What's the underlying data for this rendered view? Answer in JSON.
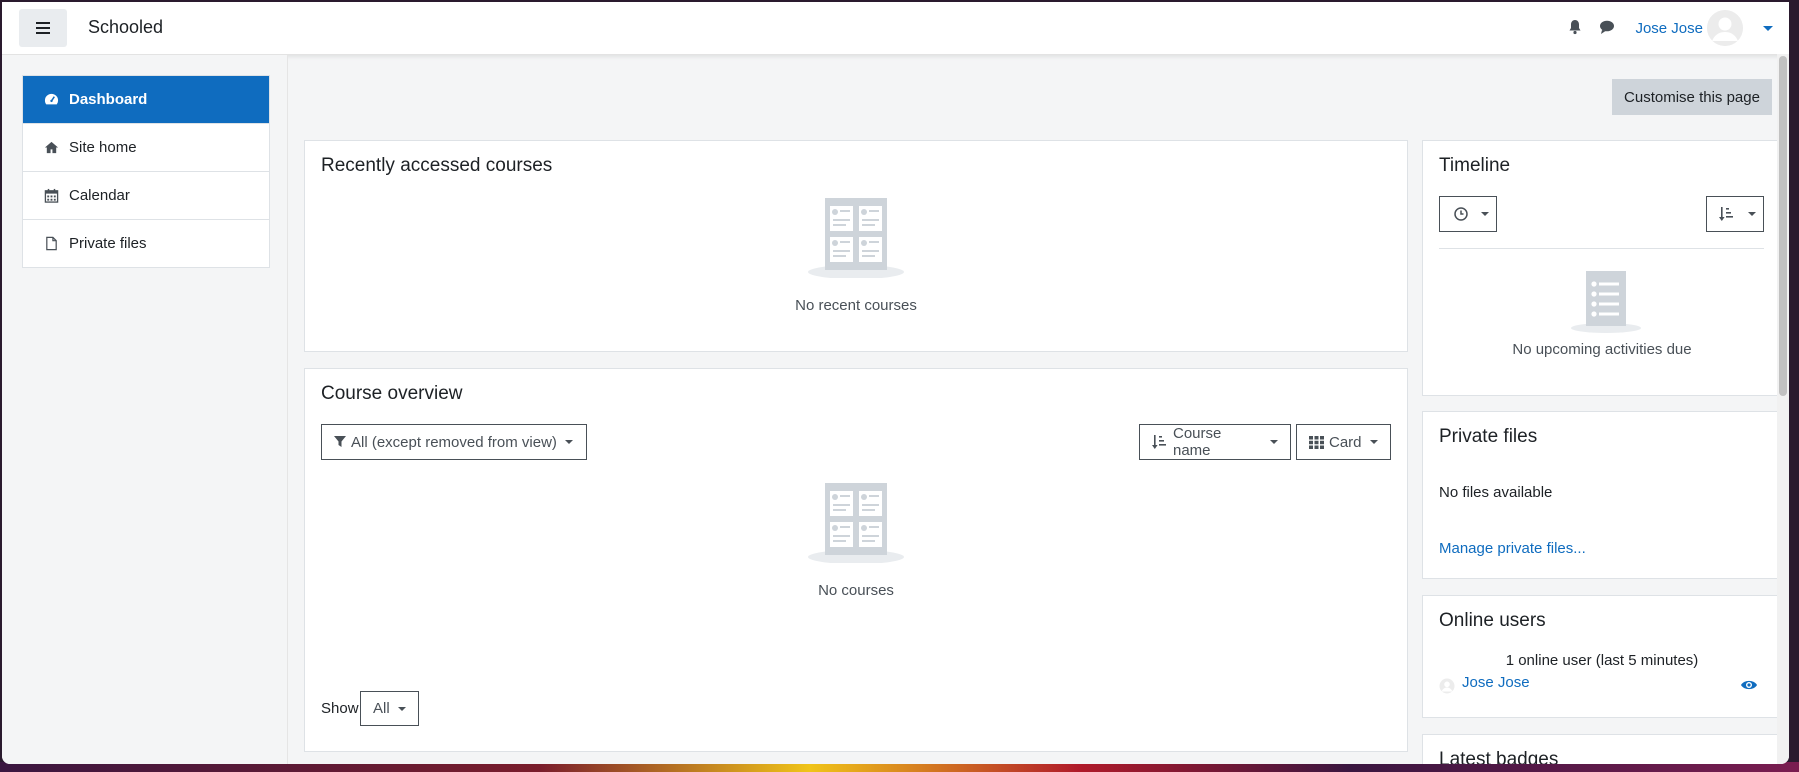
{
  "navbar": {
    "site_name": "Schooled",
    "user_name": "Jose Jose"
  },
  "sidebar": {
    "items": [
      {
        "label": "Dashboard",
        "icon": "dashboard-icon",
        "active": true
      },
      {
        "label": "Site home",
        "icon": "home-icon"
      },
      {
        "label": "Calendar",
        "icon": "calendar-icon"
      },
      {
        "label": "Private files",
        "icon": "file-icon"
      }
    ]
  },
  "main": {
    "customise_label": "Customise this page",
    "recent": {
      "title": "Recently accessed courses",
      "empty_text": "No recent courses"
    },
    "overview": {
      "title": "Course overview",
      "filter_label": "All (except removed from view)",
      "sort_label": "Course name",
      "view_label": "Card",
      "empty_text": "No courses",
      "show_label": "Show",
      "show_value": "All"
    }
  },
  "blocks": {
    "timeline": {
      "title": "Timeline",
      "empty_text": "No upcoming activities due"
    },
    "private_files": {
      "title": "Private files",
      "empty_text": "No files available",
      "manage_link": "Manage private files..."
    },
    "online_users": {
      "title": "Online users",
      "summary": "1 online user (last 5 minutes)",
      "user": "Jose Jose"
    },
    "latest_badges": {
      "title": "Latest badges"
    }
  },
  "colors": {
    "accent": "#0f6cbf",
    "page_bg": "#f4f5f6"
  }
}
